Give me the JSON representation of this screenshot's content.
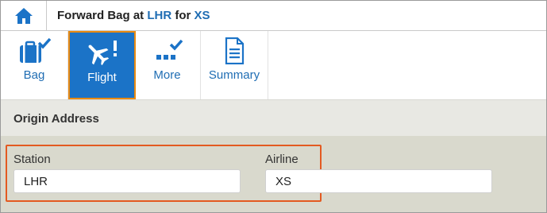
{
  "header": {
    "title_prefix": "Forward Bag at",
    "title_station": "LHR",
    "title_for": "for",
    "title_airline": "XS",
    "home_icon": "home-icon"
  },
  "toolbar": {
    "items": [
      {
        "label": "Bag",
        "icon": "suitcase-check-icon",
        "status": "complete"
      },
      {
        "label": "Flight",
        "icon": "airplane-alert-icon",
        "status": "active-attention"
      },
      {
        "label": "More",
        "icon": "dots-check-icon",
        "status": "complete"
      },
      {
        "label": "Summary",
        "icon": "document-icon",
        "status": "none"
      }
    ]
  },
  "origin": {
    "section_title": "Origin Address",
    "station": {
      "label": "Station",
      "value": "LHR"
    },
    "airline": {
      "label": "Airline",
      "value": "XS"
    }
  },
  "colors": {
    "accent_blue": "#1b73c7",
    "text_blue": "#1f6db3",
    "active_border": "#e88a12",
    "highlight_border": "#e35a21",
    "section_bg": "#e8e8e3",
    "form_bg": "#d9d9cd"
  }
}
